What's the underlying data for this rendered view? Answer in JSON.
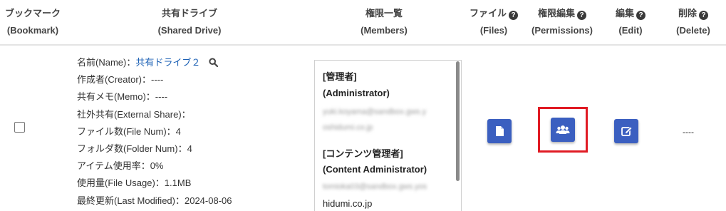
{
  "header": {
    "bookmark": {
      "jp": "ブックマーク",
      "en": "(Bookmark)"
    },
    "shared_drive": {
      "jp": "共有ドライブ",
      "en": "(Shared Drive)"
    },
    "members": {
      "jp": "権限一覧",
      "en": "(Members)"
    },
    "files": {
      "jp": "ファイル",
      "en": "(Files)"
    },
    "permissions": {
      "jp": "権限編集",
      "en": "(Permissions)"
    },
    "edit": {
      "jp": "編集",
      "en": "(Edit)"
    },
    "delete": {
      "jp": "削除",
      "en": "(Delete)"
    },
    "help_glyph": "?"
  },
  "row": {
    "info": {
      "name_label": "名前(Name)：",
      "name_value": "共有ドライブ２",
      "creator": "作成者(Creator)：----",
      "memo": "共有メモ(Memo)：----",
      "external_share": "社外共有(External Share)：",
      "file_num": "ファイル数(File Num)：4",
      "folder_num": "フォルダ数(Folder Num)：4",
      "item_usage": "アイテム使用率：0%",
      "file_usage": "使用量(File Usage)：1.1MB",
      "last_modified": "最終更新(Last Modified)：2024-08-06"
    },
    "members": {
      "admin_jp": "[管理者]",
      "admin_en": "(Administrator)",
      "admin_email_1": "yuki.koyama@sandbox.gws.y",
      "admin_email_2": "oshidumi.co.jp",
      "content_admin_jp": "[コンテンツ管理者]",
      "content_admin_en": "(Content Administrator)",
      "content_email_1": "tomioka03@sandbox.gws.yos",
      "content_email_2": "hidumi.co.jp"
    },
    "delete_value": "----"
  },
  "icons": {
    "search": "search-icon",
    "file": "file-icon",
    "users": "users-icon",
    "edit": "edit-icon"
  },
  "colors": {
    "button": "#3b5fc0",
    "link": "#1a5fb4",
    "highlight": "#e01b24"
  }
}
